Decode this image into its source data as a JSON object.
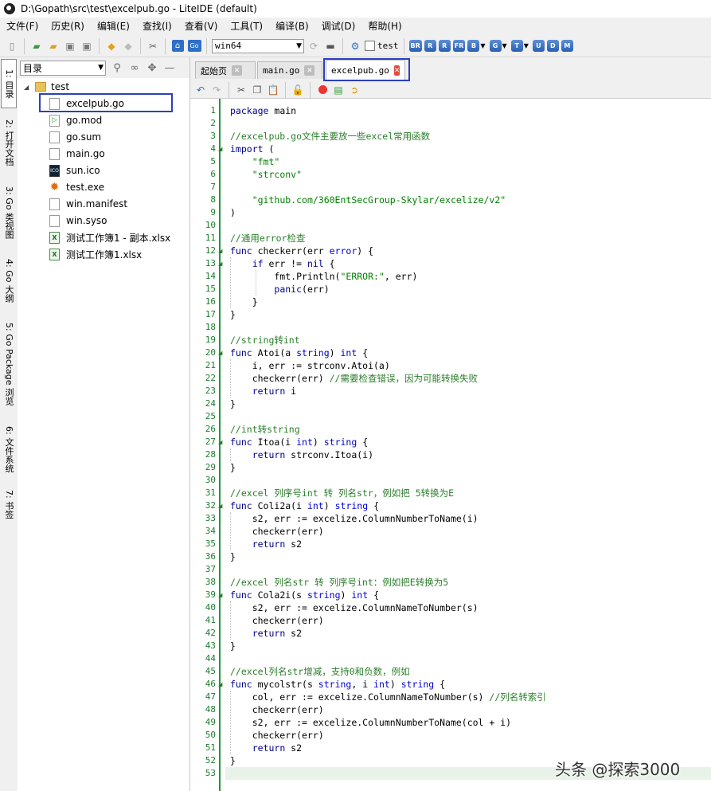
{
  "window": {
    "title": "D:\\Gopath\\src\\test\\excelpub.go - LiteIDE (default)"
  },
  "menu": [
    "文件(F)",
    "历史(R)",
    "编辑(E)",
    "查找(I)",
    "查看(V)",
    "工具(T)",
    "编译(B)",
    "调试(D)",
    "帮助(H)"
  ],
  "toolbar": {
    "env_select": "win64",
    "test_checkbox_label": "test",
    "build_buttons": [
      "BR",
      "R",
      "R",
      "FR",
      "B",
      "G",
      "T",
      "U",
      "D",
      "M"
    ]
  },
  "vertical_tabs": [
    "1: 目录",
    "2: 打开文档",
    "3: Go 类视图",
    "4: Go 大纲",
    "5: Go Package 浏览",
    "6: 文件系统",
    "7: 书签"
  ],
  "left_panel": {
    "selector": "目录",
    "tree": {
      "root": "test",
      "files": [
        {
          "name": "excelpub.go",
          "icon": "go-file-icon"
        },
        {
          "name": "go.mod",
          "icon": "mod-file-icon"
        },
        {
          "name": "go.sum",
          "icon": "file-icon"
        },
        {
          "name": "main.go",
          "icon": "file-icon"
        },
        {
          "name": "sun.ico",
          "icon": "ico-file-icon"
        },
        {
          "name": "test.exe",
          "icon": "exe-file-icon"
        },
        {
          "name": "win.manifest",
          "icon": "file-icon"
        },
        {
          "name": "win.syso",
          "icon": "file-icon"
        },
        {
          "name": "测试工作簿1 - 副本.xlsx",
          "icon": "xlsx-file-icon"
        },
        {
          "name": "测试工作簿1.xlsx",
          "icon": "xlsx-file-icon"
        }
      ]
    }
  },
  "editor_tabs": [
    {
      "label": "起始页",
      "active": false
    },
    {
      "label": "main.go",
      "active": false
    },
    {
      "label": "excelpub.go",
      "active": true
    }
  ],
  "code_lines": [
    "package main",
    "",
    "//excelpub.go文件主要放一些excel常用函数",
    "import (",
    "    \"fmt\"",
    "    \"strconv\"",
    "",
    "    \"github.com/360EntSecGroup-Skylar/excelize/v2\"",
    ")",
    "",
    "//通用error检查",
    "func checkerr(err error) {",
    "    if err != nil {",
    "        fmt.Println(\"ERROR:\", err)",
    "        panic(err)",
    "    }",
    "}",
    "",
    "//string转int",
    "func Atoi(a string) int {",
    "    i, err := strconv.Atoi(a)",
    "    checkerr(err) //需要检查错误，因为可能转换失败",
    "    return i",
    "}",
    "",
    "//int转string",
    "func Itoa(i int) string {",
    "    return strconv.Itoa(i)",
    "}",
    "",
    "//excel 列序号int 转 列名str，例如把 5转换为E",
    "func Coli2a(i int) string {",
    "    s2, err := excelize.ColumnNumberToName(i)",
    "    checkerr(err)",
    "    return s2",
    "}",
    "",
    "//excel 列名str 转 列序号int：例如把E转换为5",
    "func Cola2i(s string) int {",
    "    s2, err := excelize.ColumnNameToNumber(s)",
    "    checkerr(err)",
    "    return s2",
    "}",
    "",
    "//excel列名str增减，支持0和负数，例如",
    "func mycolstr(s string, i int) string {",
    "    col, err := excelize.ColumnNameToNumber(s) //列名转索引",
    "    checkerr(err)",
    "    s2, err := excelize.ColumnNumberToName(col + i)",
    "    checkerr(err)",
    "    return s2",
    "}",
    ""
  ],
  "watermark": "头条 @探索3000"
}
